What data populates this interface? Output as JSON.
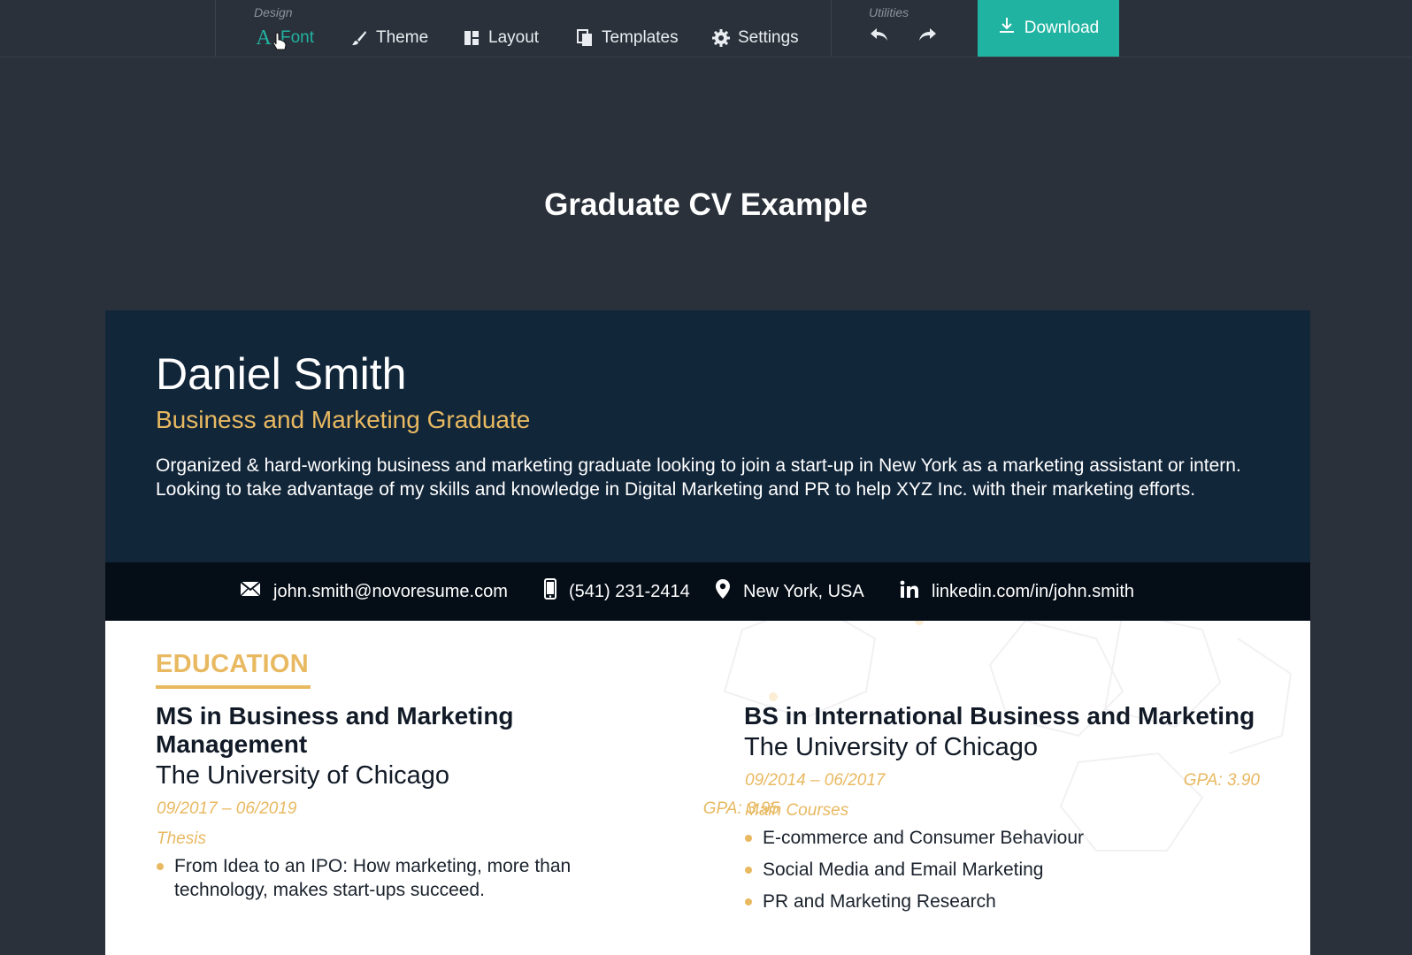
{
  "toolbar": {
    "design_label": "Design",
    "utilities_label": "Utilities",
    "tools": {
      "font": "Font",
      "theme": "Theme",
      "layout": "Layout",
      "templates": "Templates",
      "settings": "Settings"
    },
    "download_label": "Download",
    "active_tool": "Font",
    "accent_color": "#21b3a1"
  },
  "page": {
    "title": "Graduate CV Example"
  },
  "resume": {
    "name": "Daniel Smith",
    "role": "Business and Marketing Graduate",
    "summary": "Organized & hard-working business and marketing graduate looking to join a start-up in New York as a marketing assistant or intern. Looking to take advantage of my skills and knowledge in Digital Marketing and PR to help XYZ Inc. with their marketing efforts.",
    "contacts": {
      "email": "john.smith@novoresume.com",
      "phone": "(541) 231-2414",
      "location": "New York, USA",
      "linkedin": "linkedin.com/in/john.smith"
    },
    "education": {
      "section_title": "EDUCATION",
      "entries": [
        {
          "degree_line1": "MS in Business and Marketing",
          "degree_line2": "Management",
          "school": "The University of Chicago",
          "dates": "09/2017 – 06/2019",
          "gpa": "GPA: 3.95",
          "sublabel": "Thesis",
          "bullets": [
            "From Idea to an IPO: How marketing, more than technology, makes start-ups succeed."
          ]
        },
        {
          "degree_line1": "BS in International Business and Marketing",
          "school": "The University of Chicago",
          "dates": "09/2014 – 06/2017",
          "gpa": "GPA: 3.90",
          "sublabel": "Main Courses",
          "bullets": [
            "E-commerce and Consumer Behaviour",
            "Social Media and Email Marketing",
            "PR and Marketing Research"
          ]
        }
      ]
    },
    "colors": {
      "header_bg": "#12263a",
      "contact_bg": "#050d17",
      "accent": "#e8b961"
    }
  }
}
